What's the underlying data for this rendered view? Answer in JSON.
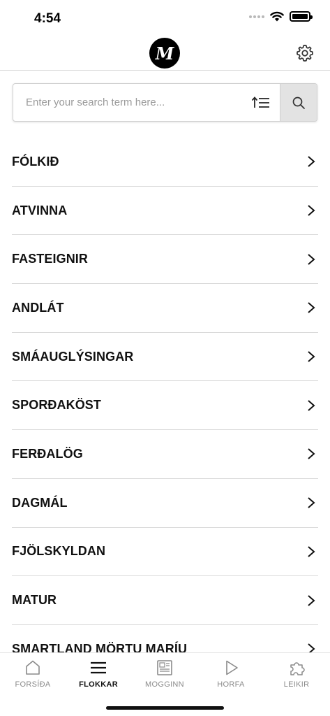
{
  "status_bar": {
    "time": "4:54"
  },
  "header": {
    "logo_letter": "M"
  },
  "search": {
    "placeholder": "Enter your search term here..."
  },
  "menu": {
    "items": [
      {
        "label": "FÓLKIÐ"
      },
      {
        "label": "ATVINNA"
      },
      {
        "label": "FASTEIGNIR"
      },
      {
        "label": "ANDLÁT"
      },
      {
        "label": "SMÁAUGLÝSINGAR"
      },
      {
        "label": "SPORÐAKÖST"
      },
      {
        "label": "FERÐALÖG"
      },
      {
        "label": "DAGMÁL"
      },
      {
        "label": "FJÖLSKYLDAN"
      },
      {
        "label": "MATUR"
      },
      {
        "label": "SMARTLAND MÖRTU MARÍU"
      }
    ]
  },
  "tabs": [
    {
      "label": "FORSÍÐA",
      "icon": "home-icon",
      "active": false
    },
    {
      "label": "FLOKKAR",
      "icon": "menu-icon",
      "active": true
    },
    {
      "label": "MOGGINN",
      "icon": "newspaper-icon",
      "active": false
    },
    {
      "label": "HORFA",
      "icon": "play-icon",
      "active": false
    },
    {
      "label": "LEIKIR",
      "icon": "puzzle-icon",
      "active": false
    }
  ],
  "colors": {
    "active_tab": "#111111",
    "inactive_tab": "#8a8a8a",
    "divider": "#d9d9d9"
  }
}
